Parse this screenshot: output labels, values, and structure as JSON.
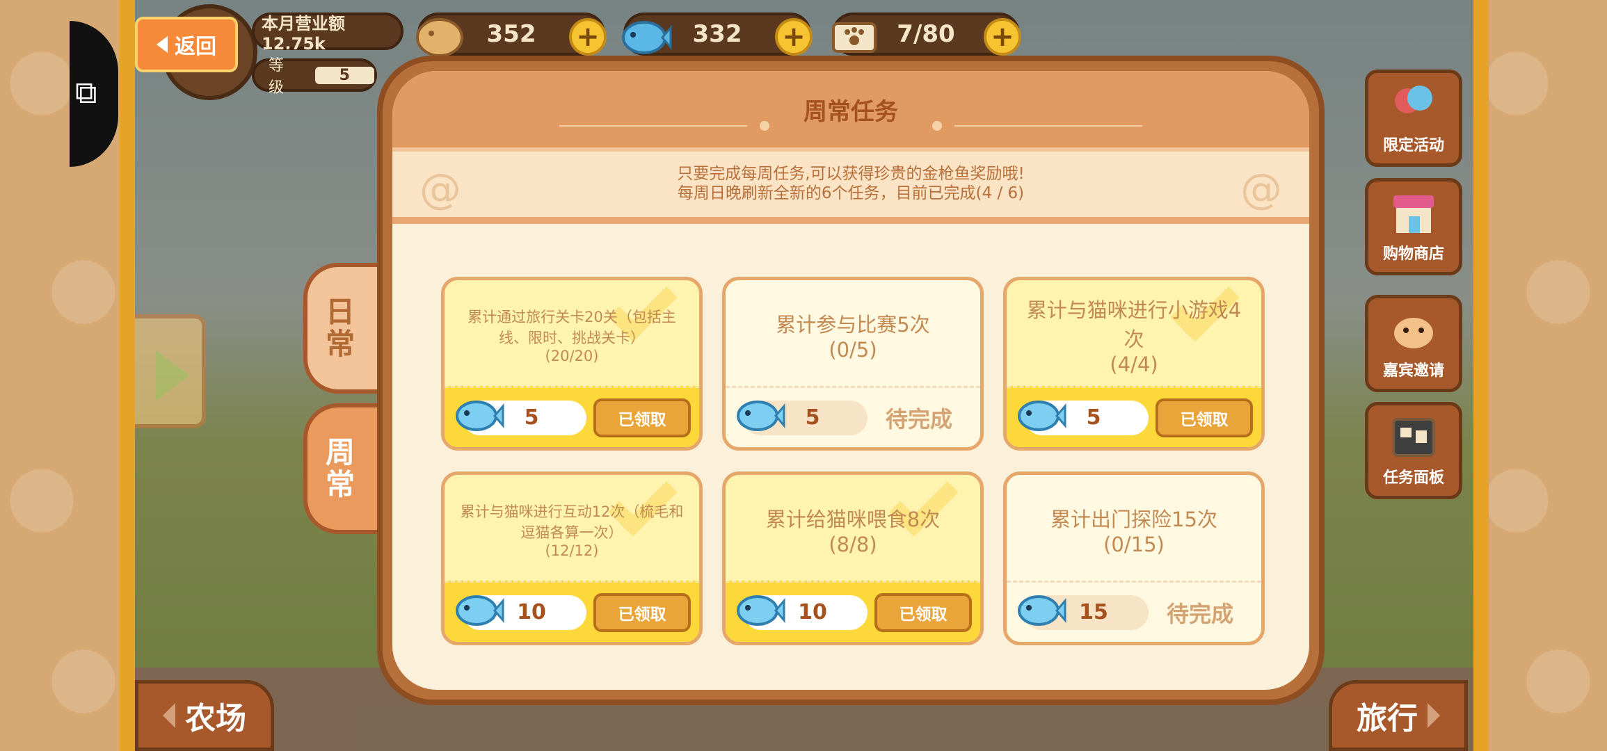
{
  "hud": {
    "back_label": "返回",
    "income_label": "本月营业额 12.75k",
    "level_label": "等级",
    "level_value": "5",
    "coins": "352",
    "fish": "332",
    "tickets": "7/80"
  },
  "tabs": {
    "daily": [
      "日",
      "常"
    ],
    "weekly": [
      "周",
      "常"
    ]
  },
  "right_menu": [
    {
      "label": "限定活动",
      "icon": "balloons-icon"
    },
    {
      "label": "购物商店",
      "icon": "shop-icon"
    },
    {
      "label": "嘉宾邀请",
      "icon": "hamster-icon"
    },
    {
      "label": "任务面板",
      "icon": "task-board-icon"
    }
  ],
  "bottom_nav": {
    "farm": "农场",
    "travel": "旅行"
  },
  "panel": {
    "title": "周常任务",
    "info_line1": "只要完成每周任务,可以获得珍贵的金枪鱼奖励哦!",
    "info_line2": "每周日晚刷新全新的6个任务，目前已完成(4 / 6)"
  },
  "tasks": [
    {
      "desc": "累计通过旅行关卡20关（包括主线、限时、挑战关卡）",
      "progress": "(20/20)",
      "reward": "5",
      "status": "已领取",
      "done": true,
      "size": "small"
    },
    {
      "desc": "累计参与比赛5次",
      "progress": "(0/5)",
      "reward": "5",
      "status": "待完成",
      "done": false,
      "size": "big"
    },
    {
      "desc": "累计与猫咪进行小游戏4次",
      "progress": "(4/4)",
      "reward": "5",
      "status": "已领取",
      "done": true,
      "size": "big"
    },
    {
      "desc": "累计与猫咪进行互动12次（梳毛和逗猫各算一次）",
      "progress": "(12/12)",
      "reward": "10",
      "status": "已领取",
      "done": true,
      "size": "small"
    },
    {
      "desc": "累计给猫咪喂食8次",
      "progress": "(8/8)",
      "reward": "10",
      "status": "已领取",
      "done": true,
      "size": "big"
    },
    {
      "desc": "累计出门探险15次",
      "progress": "(0/15)",
      "reward": "15",
      "status": "待完成",
      "done": false,
      "size": "big"
    }
  ]
}
